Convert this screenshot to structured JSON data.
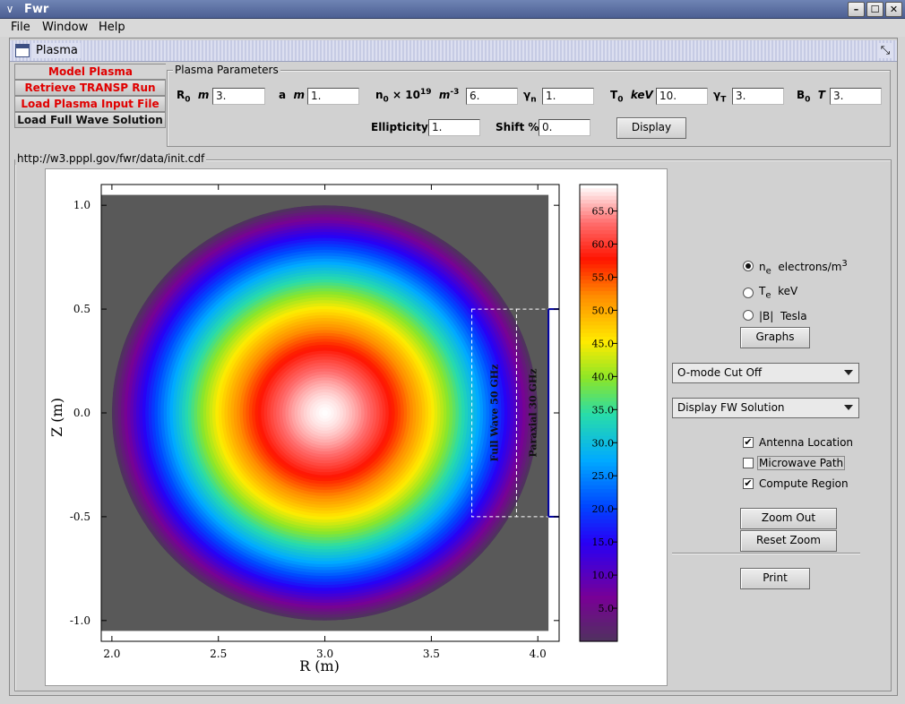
{
  "window": {
    "title": "Fwr",
    "sysmenu_glyph": "∨",
    "btn_minimize": "–",
    "btn_maximize": "☐",
    "btn_close": "✕"
  },
  "menu": [
    "File",
    "Window",
    "Help"
  ],
  "internal_frame": {
    "title": "Plasma",
    "restore_glyph": "⤡"
  },
  "tabs": [
    "Model Plasma",
    "Retrieve TRANSP Run",
    "Load Plasma Input File",
    "Load Full Wave Solution"
  ],
  "params": {
    "group_title": "Plasma Parameters",
    "R0": {
      "value": "3."
    },
    "a": {
      "value": "1."
    },
    "n0": {
      "value": "6."
    },
    "gamma_n": {
      "value": "1."
    },
    "T0": {
      "value": "10."
    },
    "gamma_T": {
      "value": "3."
    },
    "B0": {
      "value": "3."
    },
    "ellipticity": {
      "label": "Ellipticity",
      "value": "1."
    },
    "shift": {
      "label": "Shift %",
      "value": "0."
    },
    "display_button": "Display",
    "labels": {
      "R0_sym": "R",
      "R0_sub": "0",
      "R0_unit": "m",
      "a_sym": "a",
      "a_unit": "m",
      "n0_sym": "n",
      "n0_sub": "0",
      "n0_mult": "× 10",
      "n0_exp": "19",
      "n0_unit": "m",
      "n0_unit_exp": "-3",
      "gn_sym": "γ",
      "gn_sub": "n",
      "T0_sym": "T",
      "T0_sub": "0",
      "T0_unit": "keV",
      "gT_sym": "γ",
      "gT_sub": "T",
      "B0_sym": "B",
      "B0_sub": "0",
      "B0_unit": "T"
    }
  },
  "file_path": "http://w3.pppl.gov/fwr/data/init.cdf",
  "radio_options": [
    {
      "sym": "n",
      "sub": "e",
      "text": "electrons/m",
      "sup": "3",
      "selected": true
    },
    {
      "sym": "T",
      "sub": "e",
      "text": "keV",
      "sup": "",
      "selected": false
    },
    {
      "sym": "|B|",
      "sub": "",
      "text": "Tesla",
      "sup": "",
      "selected": false
    }
  ],
  "graphs_button": "Graphs",
  "dropdowns": {
    "cutoff": "O-mode Cut Off",
    "fw": "Display FW Solution"
  },
  "checkboxes": [
    {
      "label": "Antenna Location",
      "checked": true
    },
    {
      "label": "Microwave Path",
      "checked": false
    },
    {
      "label": "Compute Region",
      "checked": true
    }
  ],
  "zoom_out_button": "Zoom Out",
  "reset_zoom_button": "Reset Zoom",
  "print_button": "Print",
  "chart_data": {
    "type": "heatmap",
    "xlabel": "R (m)",
    "ylabel": "Z (m)",
    "xlim": [
      1.95,
      4.1
    ],
    "ylim": [
      -1.1,
      1.1
    ],
    "x_ticks": [
      "2.0",
      "2.5",
      "3.0",
      "3.5",
      "4.0"
    ],
    "y_ticks": [
      "1.0",
      "0.5",
      "0.0",
      "-0.5",
      "-1.0"
    ],
    "colorbar_ticks": [
      "65.0",
      "60.0",
      "55.0",
      "50.0",
      "45.0",
      "40.0",
      "35.0",
      "30.0",
      "25.0",
      "20.0",
      "15.0",
      "10.0",
      "5.0"
    ],
    "colorbar_range": [
      0,
      69
    ],
    "plasma": {
      "center_R": 3.0,
      "center_Z": 0.0,
      "minor_radius": 1.0,
      "peak": 69
    },
    "compute_regions": [
      {
        "label": "Full Wave 50 GHz",
        "R": [
          3.69,
          3.9
        ],
        "Z": [
          -0.5,
          0.5
        ]
      },
      {
        "label": "Paraxial 30 GHz",
        "R": [
          3.9,
          4.05
        ],
        "Z": [
          -0.5,
          0.5
        ]
      }
    ],
    "antenna": {
      "R": 4.05,
      "Z": [
        -0.5,
        0.5
      ]
    },
    "colors": {
      "background": "#595959"
    }
  }
}
